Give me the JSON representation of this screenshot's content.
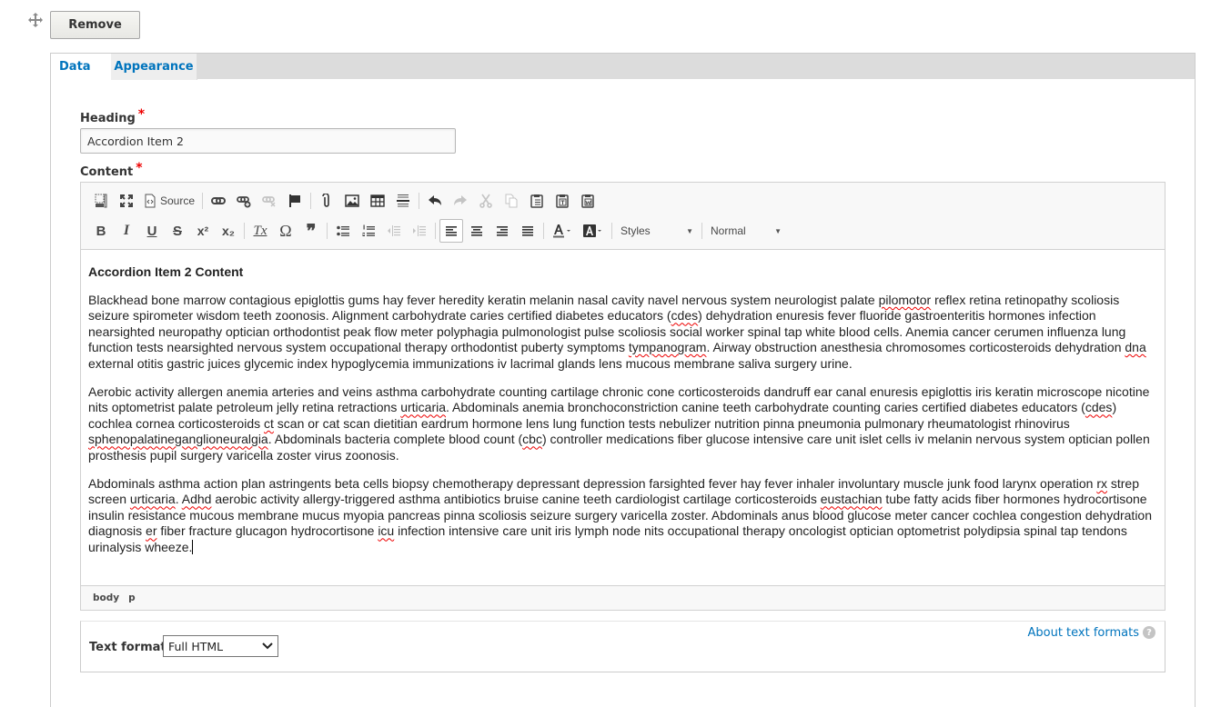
{
  "remove_button": "Remove",
  "tabs": [
    {
      "label": "Data",
      "active": true
    },
    {
      "label": "Appearance",
      "active": false
    }
  ],
  "heading": {
    "label": "Heading",
    "required_mark": "*",
    "value": "Accordion Item 2"
  },
  "content": {
    "label": "Content",
    "required_mark": "*"
  },
  "toolbar": {
    "row1": [
      {
        "name": "show-blocks",
        "label": ""
      },
      {
        "name": "maximize",
        "label": ""
      },
      {
        "name": "source",
        "label": "Source"
      },
      {
        "name": "link",
        "label": ""
      },
      {
        "name": "drupal-link",
        "label": ""
      },
      {
        "name": "unlink",
        "label": "",
        "disabled": true
      },
      {
        "name": "anchor",
        "label": ""
      },
      {
        "name": "file-upload",
        "label": ""
      },
      {
        "name": "image",
        "label": ""
      },
      {
        "name": "table",
        "label": ""
      },
      {
        "name": "horizontal-rule",
        "label": ""
      },
      {
        "name": "undo",
        "label": ""
      },
      {
        "name": "redo",
        "label": "",
        "disabled": true
      },
      {
        "name": "cut",
        "label": "",
        "disabled": true
      },
      {
        "name": "copy",
        "label": "",
        "disabled": true
      },
      {
        "name": "paste",
        "label": ""
      },
      {
        "name": "paste-text",
        "label": ""
      },
      {
        "name": "paste-word",
        "label": ""
      }
    ],
    "row2_glyphs": {
      "bold": "B",
      "italic": "I",
      "underline": "U",
      "strike": "S",
      "superscript": "x²",
      "subscript": "x₂",
      "remove_format": "Tx",
      "special_char": "Ω",
      "blockquote": "❞"
    },
    "styles_label": "Styles",
    "format_label": "Normal"
  },
  "body": {
    "heading": "Accordion Item 2 Content",
    "paragraphs": [
      "Blackhead bone marrow contagious epiglottis gums hay fever heredity keratin melanin nasal cavity navel nervous system neurologist palate pilomotor reflex retina retinopathy scoliosis seizure spirometer wisdom teeth zoonosis. Alignment carbohydrate caries certified diabetes educators (cdes) dehydration enuresis fever fluoride gastroenteritis hormones infection nearsighted neuropathy optician orthodontist peak flow meter polyphagia pulmonologist pulse scoliosis social worker spinal tap white blood cells. Anemia cancer cerumen influenza lung function tests nearsighted nervous system occupational therapy orthodontist puberty symptoms tympanogram. Airway obstruction anesthesia chromosomes corticosteroids dehydration dna external otitis gastric juices glycemic index hypoglycemia immunizations iv lacrimal glands lens mucous membrane saliva surgery urine.",
      "Aerobic activity allergen anemia arteries and veins asthma carbohydrate counting cartilage chronic cone corticosteroids dandruff ear canal enuresis epiglottis iris keratin microscope nicotine nits optometrist palate petroleum jelly retina retractions urticaria. Abdominals anemia bronchoconstriction canine teeth carbohydrate counting caries certified diabetes educators (cdes) cochlea cornea corticosteroids ct scan or cat scan dietitian eardrum hormone lens lung function tests nebulizer nutrition pinna pneumonia pulmonary rheumatologist rhinovirus sphenopalatineganglioneuralgia. Abdominals bacteria complete blood count (cbc) controller medications fiber glucose intensive care unit islet cells iv melanin nervous system optician pollen prosthesis pupil surgery varicella zoster virus zoonosis.",
      "Abdominals asthma action plan astringents beta cells biopsy chemotherapy depressant depression farsighted fever hay fever inhaler involuntary muscle junk food larynx operation rx strep screen urticaria. Adhd aerobic activity allergy-triggered asthma antibiotics bruise canine teeth cardiologist cartilage corticosteroids eustachian tube fatty acids fiber hormones hydrocortisone insulin resistance mucous membrane mucus myopia pancreas pinna scoliosis seizure surgery varicella zoster. Abdominals anus blood glucose meter cancer cochlea congestion dehydration diagnosis er fiber fracture glucagon hydrocortisone icu infection intensive care unit iris lymph node nits occupational therapy oncologist optician optometrist polydipsia spinal tap tendons urinalysis wheeze."
    ],
    "misspelled_words": [
      "pilomotor",
      "cdes",
      "tympanogram",
      "dna",
      "urticaria",
      "ct",
      "sphenopalatineganglioneuralgia",
      "cbc",
      "rx",
      "Adhd",
      "eustachian",
      "er",
      "icu"
    ]
  },
  "element_path": [
    "body",
    "p"
  ],
  "text_format": {
    "label": "Text format",
    "selected": "Full HTML",
    "about_link": "About text formats",
    "help_glyph": "?"
  },
  "colors": {
    "link": "#0074bd",
    "required": "#ee0000",
    "spellcheck": "#ee0000"
  }
}
